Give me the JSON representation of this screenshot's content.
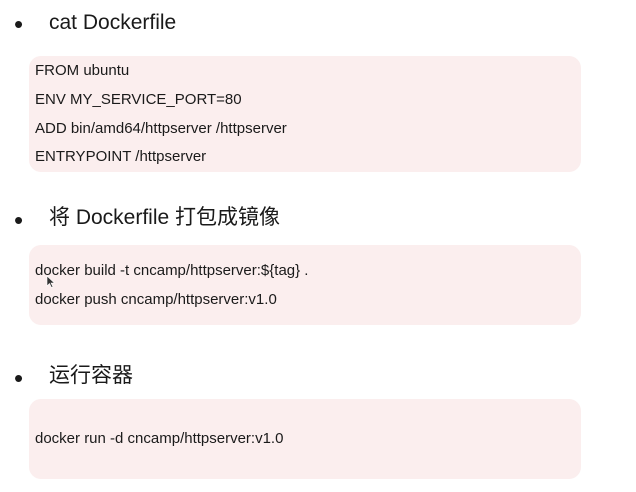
{
  "sections": [
    {
      "heading": "cat Dockerfile",
      "lines": [
        "FROM ubuntu",
        "ENV MY_SERVICE_PORT=80",
        "ADD bin/amd64/httpserver /httpserver",
        "ENTRYPOINT /httpserver"
      ]
    },
    {
      "heading": "将 Dockerfile 打包成镜像",
      "lines": [
        "docker build -t cncamp/httpserver:${tag} .",
        "docker push cncamp/httpserver:v1.0"
      ]
    },
    {
      "heading": "运行容器",
      "lines": [
        "docker run -d cncamp/httpserver:v1.0"
      ]
    }
  ],
  "bullet_glyph": "•",
  "colors": {
    "code_background": "#fbeeee",
    "text": "#1a1a1a"
  }
}
